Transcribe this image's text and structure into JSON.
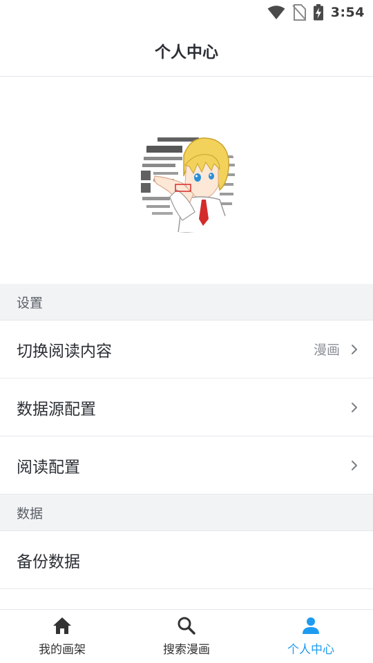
{
  "status_bar": {
    "time": "3:54",
    "icons": [
      "wifi-icon",
      "no-sim-icon",
      "battery-charging-icon"
    ]
  },
  "header": {
    "title": "个人中心"
  },
  "profile": {
    "avatar_icon": "avatar-anime-illustration"
  },
  "sections": [
    {
      "title": "设置",
      "items": [
        {
          "label": "切换阅读内容",
          "value": "漫画"
        },
        {
          "label": "数据源配置",
          "value": ""
        },
        {
          "label": "阅读配置",
          "value": ""
        }
      ]
    },
    {
      "title": "数据",
      "items": [
        {
          "label": "备份数据",
          "value": ""
        }
      ]
    }
  ],
  "tabbar": {
    "tabs": [
      {
        "label": "我的画架",
        "icon": "home-icon",
        "active": false
      },
      {
        "label": "搜索漫画",
        "icon": "search-icon",
        "active": false
      },
      {
        "label": "个人中心",
        "icon": "person-icon",
        "active": true
      }
    ],
    "accent_color": "#1d9bf0"
  }
}
